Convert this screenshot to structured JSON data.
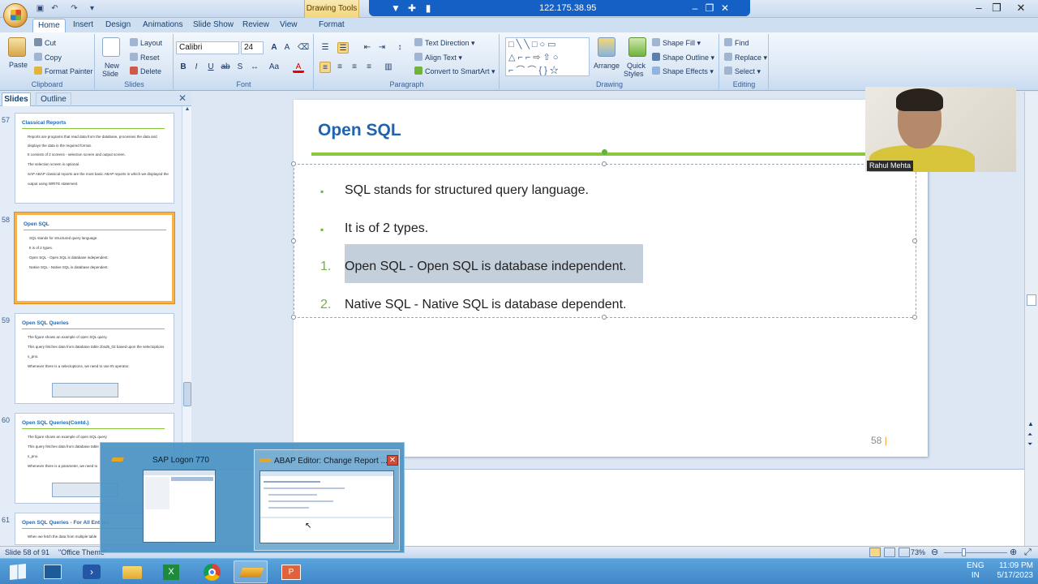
{
  "titlebar": {
    "contextual_tab": "Drawing Tools",
    "remote_ip": "122.175.38.95"
  },
  "tabs": [
    {
      "label": "Home"
    },
    {
      "label": "Insert"
    },
    {
      "label": "Design"
    },
    {
      "label": "Animations"
    },
    {
      "label": "Slide Show"
    },
    {
      "label": "Review"
    },
    {
      "label": "View"
    },
    {
      "label": "Format"
    }
  ],
  "ribbon": {
    "clipboard": {
      "paste": "Paste",
      "cut": "Cut",
      "copy": "Copy",
      "format_painter": "Format Painter",
      "label": "Clipboard"
    },
    "slides": {
      "new_slide": "New",
      "new_slide2": "Slide",
      "layout": "Layout",
      "reset": "Reset",
      "delete": "Delete",
      "label": "Slides"
    },
    "font": {
      "family": "Calibri",
      "size": "24",
      "label": "Font"
    },
    "paragraph": {
      "text_direction": "Text Direction",
      "align_text": "Align Text",
      "convert_smartart": "Convert to SmartArt",
      "label": "Paragraph"
    },
    "drawing": {
      "arrange": "Arrange",
      "quick": "Quick",
      "styles": "Styles",
      "shape_fill": "Shape Fill",
      "shape_outline": "Shape Outline",
      "shape_effects": "Shape Effects",
      "label": "Drawing"
    },
    "editing": {
      "find": "Find",
      "replace": "Replace",
      "select": "Select",
      "label": "Editing"
    }
  },
  "leftpane": {
    "tab_slides": "Slides",
    "tab_outline": "Outline",
    "thumbs": [
      {
        "num": "57",
        "title": "Classical Reports",
        "lines": [
          "Reports are programs that read data from the database, processes the data and",
          "displays the data in the required format.",
          "It consists of 2 screens - selection screen and output screen.",
          "The selection screen is optional.",
          "SAP ABAP classical reports are the most basic ABAP reports in which we displayed the",
          "output using WRITE statement."
        ]
      },
      {
        "num": "58",
        "title": "Open SQL",
        "lines": [
          "SQL stands for structured query language.",
          "It is of 2 types.",
          "Open SQL - Open SQL is database independent.",
          "Native SQL - Native SQL is database dependent."
        ]
      },
      {
        "num": "59",
        "title": "Open SQL Queries",
        "lines": [
          "The figure shows an example of open SQL query.",
          "This query fetches data from database table zbsd5_02 based upon the selectoptions",
          "s_pno.",
          "Whenever there is a selectoptions, we need to use IN operator."
        ]
      },
      {
        "num": "60",
        "title": "Open SQL Queries(Contd.)",
        "lines": [
          "The figure shows an example of open SQL query.",
          "This query fetches data from database table",
          "s_pno.",
          "Whenever there is a parameter, we need to"
        ]
      },
      {
        "num": "61",
        "title": "Open SQL Queries - For All Entries",
        "lines": [
          "When we fetch the data from multiple table"
        ]
      }
    ]
  },
  "slide": {
    "title": "Open SQL",
    "bullets": [
      {
        "marker": "▪",
        "text": "SQL stands for structured query language."
      },
      {
        "marker": "▪",
        "text": "It is of 2 types."
      },
      {
        "marker": "1.",
        "text": "Open SQL - Open SQL is database independent."
      },
      {
        "marker": "2.",
        "text": "Native SQL - Native SQL is database dependent."
      }
    ],
    "page_number": "58"
  },
  "webcam": {
    "name": "Rahul Mehta"
  },
  "taskbar_preview": {
    "item1": "SAP Logon 770",
    "item2": "ABAP Editor: Change Report ..."
  },
  "statusbar": {
    "slide_info": "Slide 58 of 91",
    "theme": "\"Office Theme\"",
    "zoom": "73%"
  },
  "tray": {
    "lang1": "ENG",
    "lang2": "IN",
    "time": "11:09 PM",
    "date": "5/17/2023"
  },
  "colors": {
    "accent_green": "#8cc63f",
    "title_blue": "#1f63b1",
    "taskbar": "#3f87c7"
  }
}
